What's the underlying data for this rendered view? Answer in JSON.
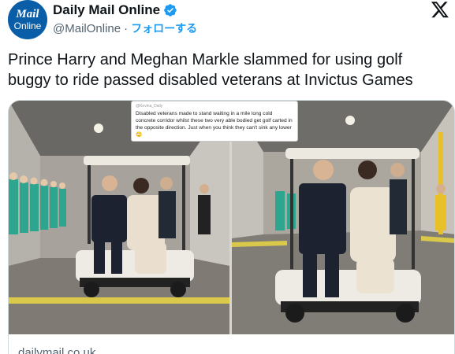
{
  "account": {
    "avatar_text_top": "Mail",
    "avatar_text_bottom": "Online",
    "display_name": "Daily Mail Online",
    "handle": "@MailOnline",
    "separator": "·",
    "follow_label": "フォローする"
  },
  "tweet": {
    "text": "Prince Harry and Meghan Markle slammed for using golf buggy to ride passed disabled veterans at Invictus Games"
  },
  "media": {
    "caption_handle": "@Kevina_Daily",
    "caption_text": "Disabled veterans made to stand waiting in a mile long cold concrete corridor whilst these two very able bodied get golf carted in the opposite direction. Just when you think they can't sink any lower 🙄"
  },
  "link_card": {
    "domain": "dailymail.co.uk"
  },
  "colors": {
    "brand_blue": "#0a5ea8",
    "follow_blue": "#1d9bf0",
    "verified_blue": "#1d9bf0",
    "muted_text": "#536471"
  },
  "icons": [
    "verified-badge-icon",
    "x-logo-icon"
  ]
}
